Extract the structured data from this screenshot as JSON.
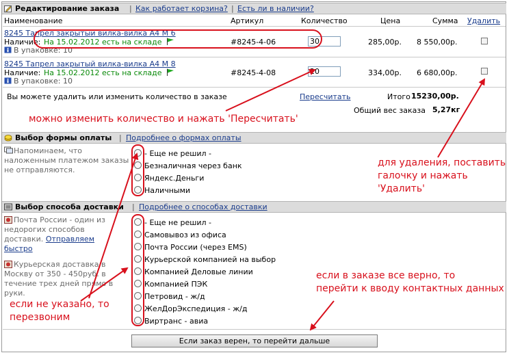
{
  "order": {
    "title": "Редактирование заказа",
    "link_basket": "Как работает корзина?",
    "link_stock": "Есть ли в наличии?",
    "columns": {
      "name": "Наименование",
      "article": "Артикул",
      "qty": "Количество",
      "price": "Цена",
      "sum": "Сумма",
      "delete": "Удалить"
    },
    "items": [
      {
        "name": "8245 Тапрел закрытый вилка-вилка A4 M 6",
        "avail_label": "Наличие:",
        "avail_value": "На 15.02.2012 есть на складе",
        "pack": "В упаковке: 10",
        "article": "#8245-4-06",
        "qty": "30",
        "price": "285,00р.",
        "sum": "8 550,00р."
      },
      {
        "name": "8245 Тапрел закрытый вилка-вилка A4 M 8",
        "avail_label": "Наличие:",
        "avail_value": "На 15.02.2012 есть на складе",
        "pack": "В упаковке: 10",
        "article": "#8245-4-08",
        "qty": "20",
        "price": "334,00р.",
        "sum": "6 680,00р."
      }
    ],
    "note": "Вы можете удалить или изменить количество в заказе",
    "recalc": "Пересчитать",
    "total_label": "Итого",
    "total_value": "15230,00р.",
    "weight_label": "Общий вес заказа",
    "weight_value": "5,27кг"
  },
  "payment": {
    "title": "Выбор формы оплаты",
    "link": "Подробнее о формах оплаты",
    "note_lines": [
      "Напоминаем, что",
      "наложенным платежом заказы",
      "не отправляются."
    ],
    "options": [
      "- Еще не решил -",
      "Безналичная через банк",
      "Яндекс.Деньги",
      "Наличными"
    ]
  },
  "delivery": {
    "title": "Выбор способа доставки",
    "link": "Подробнее о способах доставки",
    "note1_lines": [
      "Почта России - один из",
      "недорогих способов",
      "доставки."
    ],
    "note1_link1": "Отправляем",
    "note1_link2": "быстро",
    "note2_lines": [
      "Курьерская доставка в",
      "Москву от 350 - 450руб. в",
      "течение трех дней прямо в",
      "руки."
    ],
    "options": [
      "- Еще не решил -",
      "Самовывоз из офиса",
      "Почта России (через EMS)",
      "Курьерской компанией на выбор",
      "Компанией Деловые линии",
      "Компанией ПЭК",
      "Петровид - ж/д",
      "ЖелДорЭкспедиция - ж/д",
      "Виртранс - авиа"
    ]
  },
  "submit_label": "Если заказ верен, то перейти дальше",
  "annotations": {
    "recalc": "можно изменить количество и нажать 'Пересчитать'",
    "delete": [
      "для удаления, поставить",
      "галочку и нажать",
      "'Удалить'"
    ],
    "callback": [
      "если не указано, то",
      "перезвоним"
    ],
    "proceed": [
      "если в заказе все верно, то",
      "перейти к вводу контактных данных"
    ]
  },
  "colors": {
    "annotation": "#d8101c",
    "link": "#1a3c8c",
    "in_stock": "#0a8a0a",
    "header_bg": "#dcdcdc"
  }
}
